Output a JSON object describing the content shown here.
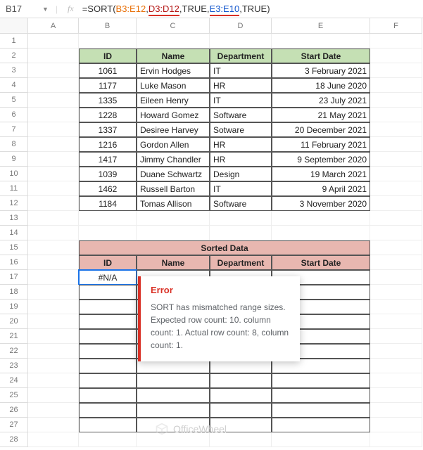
{
  "formula_bar": {
    "cell_ref": "B17",
    "fx": "fx",
    "prefix": "=SORT(",
    "r1": "B3:E12",
    "c1": ",",
    "r2": "D3:D12",
    "c2": ",",
    "k1": "TRUE",
    "c3": ",",
    "r3": "E3:E10",
    "c4": ",",
    "k2": "TRUE",
    "suffix": ")"
  },
  "columns": [
    "A",
    "B",
    "C",
    "D",
    "E",
    "F"
  ],
  "row_count": 28,
  "table1": {
    "headers": [
      "ID",
      "Name",
      "Department",
      "Start Date"
    ],
    "rows": [
      [
        "1061",
        "Ervin Hodges",
        "IT",
        "3 February 2021"
      ],
      [
        "1177",
        "Luke Mason",
        "HR",
        "18 June 2020"
      ],
      [
        "1335",
        "Eileen Henry",
        "IT",
        "23 July 2021"
      ],
      [
        "1228",
        "Howard Gomez",
        "Software",
        "21 May 2021"
      ],
      [
        "1337",
        "Desiree Harvey",
        "Sotware",
        "20 December 2021"
      ],
      [
        "1216",
        "Gordon Allen",
        "HR",
        "11 February 2021"
      ],
      [
        "1417",
        "Jimmy Chandler",
        "HR",
        "9 September 2020"
      ],
      [
        "1039",
        "Duane Schwartz",
        "Design",
        "19 March 2021"
      ],
      [
        "1462",
        "Russell Barton",
        "IT",
        "9 April 2021"
      ],
      [
        "1184",
        "Tomas Allison",
        "Software",
        "3 November 2020"
      ]
    ]
  },
  "table2": {
    "title": "Sorted Data",
    "headers": [
      "ID",
      "Name",
      "Department",
      "Start Date"
    ],
    "error_value": "#N/A",
    "empty_rows": 10
  },
  "error_tooltip": {
    "title": "Error",
    "message": "SORT has mismatched range sizes. Expected row count: 10. column count: 1. Actual row count: 8, column count: 1."
  },
  "watermark": "OfficeWheel"
}
